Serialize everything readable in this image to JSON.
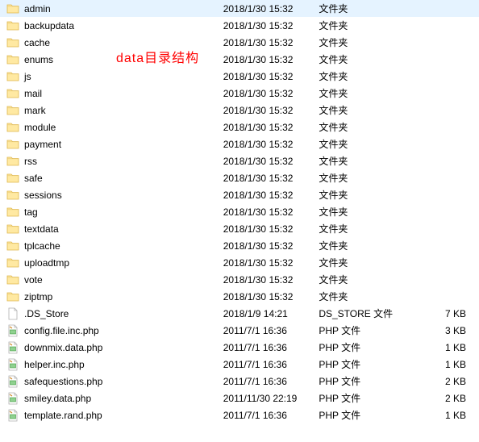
{
  "annotation": "data目录结构",
  "type_labels": {
    "folder": "文件夹",
    "ds_store": "DS_STORE 文件",
    "php": "PHP 文件"
  },
  "items": [
    {
      "name": "admin",
      "date": "2018/1/30 15:32",
      "type": "folder",
      "size": ""
    },
    {
      "name": "backupdata",
      "date": "2018/1/30 15:32",
      "type": "folder",
      "size": ""
    },
    {
      "name": "cache",
      "date": "2018/1/30 15:32",
      "type": "folder",
      "size": ""
    },
    {
      "name": "enums",
      "date": "2018/1/30 15:32",
      "type": "folder",
      "size": ""
    },
    {
      "name": "js",
      "date": "2018/1/30 15:32",
      "type": "folder",
      "size": ""
    },
    {
      "name": "mail",
      "date": "2018/1/30 15:32",
      "type": "folder",
      "size": ""
    },
    {
      "name": "mark",
      "date": "2018/1/30 15:32",
      "type": "folder",
      "size": ""
    },
    {
      "name": "module",
      "date": "2018/1/30 15:32",
      "type": "folder",
      "size": ""
    },
    {
      "name": "payment",
      "date": "2018/1/30 15:32",
      "type": "folder",
      "size": ""
    },
    {
      "name": "rss",
      "date": "2018/1/30 15:32",
      "type": "folder",
      "size": ""
    },
    {
      "name": "safe",
      "date": "2018/1/30 15:32",
      "type": "folder",
      "size": ""
    },
    {
      "name": "sessions",
      "date": "2018/1/30 15:32",
      "type": "folder",
      "size": ""
    },
    {
      "name": "tag",
      "date": "2018/1/30 15:32",
      "type": "folder",
      "size": ""
    },
    {
      "name": "textdata",
      "date": "2018/1/30 15:32",
      "type": "folder",
      "size": ""
    },
    {
      "name": "tplcache",
      "date": "2018/1/30 15:32",
      "type": "folder",
      "size": ""
    },
    {
      "name": "uploadtmp",
      "date": "2018/1/30 15:32",
      "type": "folder",
      "size": ""
    },
    {
      "name": "vote",
      "date": "2018/1/30 15:32",
      "type": "folder",
      "size": ""
    },
    {
      "name": "ziptmp",
      "date": "2018/1/30 15:32",
      "type": "folder",
      "size": ""
    },
    {
      "name": ".DS_Store",
      "date": "2018/1/9 14:21",
      "type": "ds_store",
      "size": "7 KB"
    },
    {
      "name": "config.file.inc.php",
      "date": "2011/7/1 16:36",
      "type": "php",
      "size": "3 KB"
    },
    {
      "name": "downmix.data.php",
      "date": "2011/7/1 16:36",
      "type": "php",
      "size": "1 KB"
    },
    {
      "name": "helper.inc.php",
      "date": "2011/7/1 16:36",
      "type": "php",
      "size": "1 KB"
    },
    {
      "name": "safequestions.php",
      "date": "2011/7/1 16:36",
      "type": "php",
      "size": "2 KB"
    },
    {
      "name": "smiley.data.php",
      "date": "2011/11/30 22:19",
      "type": "php",
      "size": "2 KB"
    },
    {
      "name": "template.rand.php",
      "date": "2011/7/1 16:36",
      "type": "php",
      "size": "1 KB"
    }
  ]
}
